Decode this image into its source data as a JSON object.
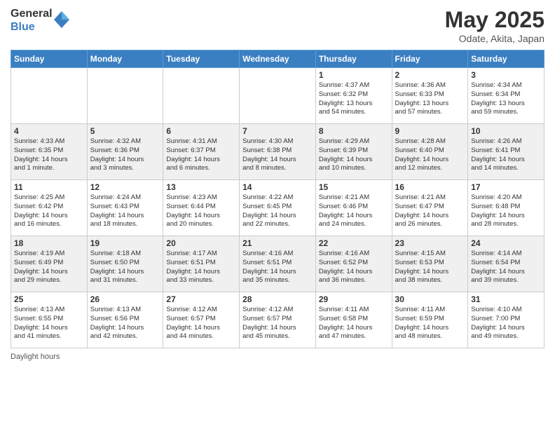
{
  "logo": {
    "general": "General",
    "blue": "Blue"
  },
  "title": "May 2025",
  "location": "Odate, Akita, Japan",
  "days_of_week": [
    "Sunday",
    "Monday",
    "Tuesday",
    "Wednesday",
    "Thursday",
    "Friday",
    "Saturday"
  ],
  "footer": {
    "daylight_label": "Daylight hours"
  },
  "weeks": [
    [
      {
        "day": "",
        "info": ""
      },
      {
        "day": "",
        "info": ""
      },
      {
        "day": "",
        "info": ""
      },
      {
        "day": "",
        "info": ""
      },
      {
        "day": "1",
        "info": "Sunrise: 4:37 AM\nSunset: 6:32 PM\nDaylight: 13 hours\nand 54 minutes."
      },
      {
        "day": "2",
        "info": "Sunrise: 4:36 AM\nSunset: 6:33 PM\nDaylight: 13 hours\nand 57 minutes."
      },
      {
        "day": "3",
        "info": "Sunrise: 4:34 AM\nSunset: 6:34 PM\nDaylight: 13 hours\nand 59 minutes."
      }
    ],
    [
      {
        "day": "4",
        "info": "Sunrise: 4:33 AM\nSunset: 6:35 PM\nDaylight: 14 hours\nand 1 minute."
      },
      {
        "day": "5",
        "info": "Sunrise: 4:32 AM\nSunset: 6:36 PM\nDaylight: 14 hours\nand 3 minutes."
      },
      {
        "day": "6",
        "info": "Sunrise: 4:31 AM\nSunset: 6:37 PM\nDaylight: 14 hours\nand 6 minutes."
      },
      {
        "day": "7",
        "info": "Sunrise: 4:30 AM\nSunset: 6:38 PM\nDaylight: 14 hours\nand 8 minutes."
      },
      {
        "day": "8",
        "info": "Sunrise: 4:29 AM\nSunset: 6:39 PM\nDaylight: 14 hours\nand 10 minutes."
      },
      {
        "day": "9",
        "info": "Sunrise: 4:28 AM\nSunset: 6:40 PM\nDaylight: 14 hours\nand 12 minutes."
      },
      {
        "day": "10",
        "info": "Sunrise: 4:26 AM\nSunset: 6:41 PM\nDaylight: 14 hours\nand 14 minutes."
      }
    ],
    [
      {
        "day": "11",
        "info": "Sunrise: 4:25 AM\nSunset: 6:42 PM\nDaylight: 14 hours\nand 16 minutes."
      },
      {
        "day": "12",
        "info": "Sunrise: 4:24 AM\nSunset: 6:43 PM\nDaylight: 14 hours\nand 18 minutes."
      },
      {
        "day": "13",
        "info": "Sunrise: 4:23 AM\nSunset: 6:44 PM\nDaylight: 14 hours\nand 20 minutes."
      },
      {
        "day": "14",
        "info": "Sunrise: 4:22 AM\nSunset: 6:45 PM\nDaylight: 14 hours\nand 22 minutes."
      },
      {
        "day": "15",
        "info": "Sunrise: 4:21 AM\nSunset: 6:46 PM\nDaylight: 14 hours\nand 24 minutes."
      },
      {
        "day": "16",
        "info": "Sunrise: 4:21 AM\nSunset: 6:47 PM\nDaylight: 14 hours\nand 26 minutes."
      },
      {
        "day": "17",
        "info": "Sunrise: 4:20 AM\nSunset: 6:48 PM\nDaylight: 14 hours\nand 28 minutes."
      }
    ],
    [
      {
        "day": "18",
        "info": "Sunrise: 4:19 AM\nSunset: 6:49 PM\nDaylight: 14 hours\nand 29 minutes."
      },
      {
        "day": "19",
        "info": "Sunrise: 4:18 AM\nSunset: 6:50 PM\nDaylight: 14 hours\nand 31 minutes."
      },
      {
        "day": "20",
        "info": "Sunrise: 4:17 AM\nSunset: 6:51 PM\nDaylight: 14 hours\nand 33 minutes."
      },
      {
        "day": "21",
        "info": "Sunrise: 4:16 AM\nSunset: 6:51 PM\nDaylight: 14 hours\nand 35 minutes."
      },
      {
        "day": "22",
        "info": "Sunrise: 4:16 AM\nSunset: 6:52 PM\nDaylight: 14 hours\nand 36 minutes."
      },
      {
        "day": "23",
        "info": "Sunrise: 4:15 AM\nSunset: 6:53 PM\nDaylight: 14 hours\nand 38 minutes."
      },
      {
        "day": "24",
        "info": "Sunrise: 4:14 AM\nSunset: 6:54 PM\nDaylight: 14 hours\nand 39 minutes."
      }
    ],
    [
      {
        "day": "25",
        "info": "Sunrise: 4:13 AM\nSunset: 6:55 PM\nDaylight: 14 hours\nand 41 minutes."
      },
      {
        "day": "26",
        "info": "Sunrise: 4:13 AM\nSunset: 6:56 PM\nDaylight: 14 hours\nand 42 minutes."
      },
      {
        "day": "27",
        "info": "Sunrise: 4:12 AM\nSunset: 6:57 PM\nDaylight: 14 hours\nand 44 minutes."
      },
      {
        "day": "28",
        "info": "Sunrise: 4:12 AM\nSunset: 6:57 PM\nDaylight: 14 hours\nand 45 minutes."
      },
      {
        "day": "29",
        "info": "Sunrise: 4:11 AM\nSunset: 6:58 PM\nDaylight: 14 hours\nand 47 minutes."
      },
      {
        "day": "30",
        "info": "Sunrise: 4:11 AM\nSunset: 6:59 PM\nDaylight: 14 hours\nand 48 minutes."
      },
      {
        "day": "31",
        "info": "Sunrise: 4:10 AM\nSunset: 7:00 PM\nDaylight: 14 hours\nand 49 minutes."
      }
    ]
  ]
}
